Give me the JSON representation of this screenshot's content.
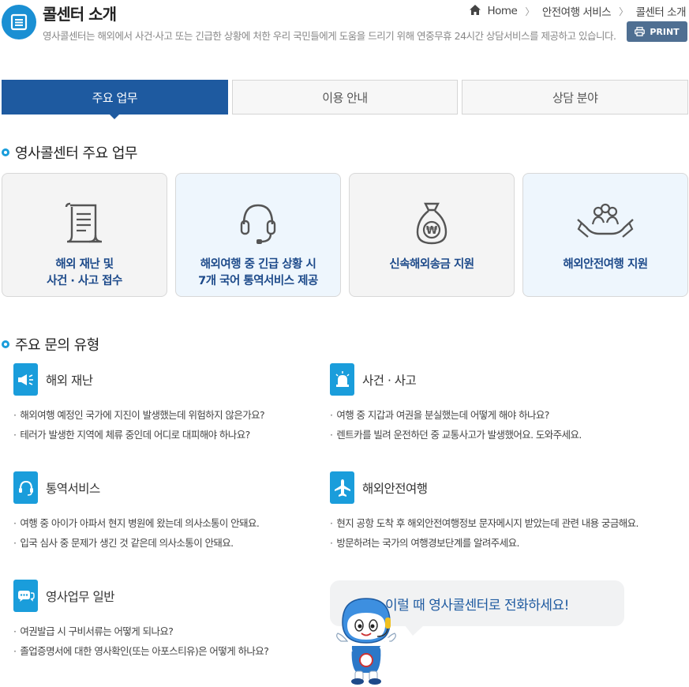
{
  "header": {
    "title": "콜센터 소개",
    "description": "영사콜센터는 해외에서 사건·사고 또는 긴급한 상황에 처한 우리 국민들에게 도움을 드리기 위해 연중무휴 24시간 상담서비스를 제공하고 있습니다.",
    "print_label": "PRINT"
  },
  "breadcrumb": {
    "home": "Home",
    "level1": "안전여행 서비스",
    "level2": "콜센터 소개"
  },
  "tabs": [
    {
      "label": "주요 업무",
      "active": true
    },
    {
      "label": "이용 안내",
      "active": false
    },
    {
      "label": "상담 분야",
      "active": false
    }
  ],
  "section1": {
    "title": "영사콜센터 주요 업무",
    "cards": [
      {
        "line1": "해외 재난 및",
        "line2": "사건 · 사고 접수",
        "icon": "document-icon"
      },
      {
        "line1": "해외여행 중 긴급 상황 시",
        "line2": "7개 국어 통역서비스 제공",
        "icon": "headset-icon"
      },
      {
        "line1": "신속해외송금 지원",
        "line2": "",
        "icon": "money-bag-icon"
      },
      {
        "line1": "해외안전여행 지원",
        "line2": "",
        "icon": "hands-people-icon"
      }
    ]
  },
  "section2": {
    "title": "주요 문의 유형",
    "categories": [
      {
        "title": "해외 재난",
        "icon": "megaphone-icon",
        "items": [
          "해외여행 예정인 국가에 지진이 발생했는데 위험하지 않은가요?",
          "테러가 발생한 지역에 체류 중인데 어디로 대피해야 하나요?"
        ]
      },
      {
        "title": "사건 · 사고",
        "icon": "siren-icon",
        "items": [
          "여행 중 지갑과 여권을 분실했는데 어떻게 해야 하나요?",
          "렌트카를 빌려 운전하던 중 교통사고가 발생했어요. 도와주세요."
        ]
      },
      {
        "title": "통역서비스",
        "icon": "headset-icon",
        "items": [
          "여행 중 아이가 아파서 현지 병원에 왔는데 의사소통이 안돼요.",
          "입국 심사 중 문제가 생긴 것 같은데 의사소통이 안돼요."
        ]
      },
      {
        "title": "해외안전여행",
        "icon": "airplane-icon",
        "items": [
          "현지 공항 도착 후 해외안전여행정보 문자메시지 받았는데 관련 내용 궁금해요.",
          "방문하려는 국가의 여행경보단계를 알려주세요."
        ]
      },
      {
        "title": "영사업무 일반",
        "icon": "chat-icon",
        "items": [
          "여권발급 시 구비서류는 어떻게 되나요?",
          "졸업증명서에 대한 영사확인(또는 아포스티유)은 어떻게 하나요?"
        ]
      }
    ]
  },
  "bubble": {
    "text": "이럴 때 영사콜센터로 전화하세요!"
  },
  "colors": {
    "primary": "#1e5aa0",
    "accent": "#1a9ddb",
    "card_label": "#1d4a8a"
  }
}
